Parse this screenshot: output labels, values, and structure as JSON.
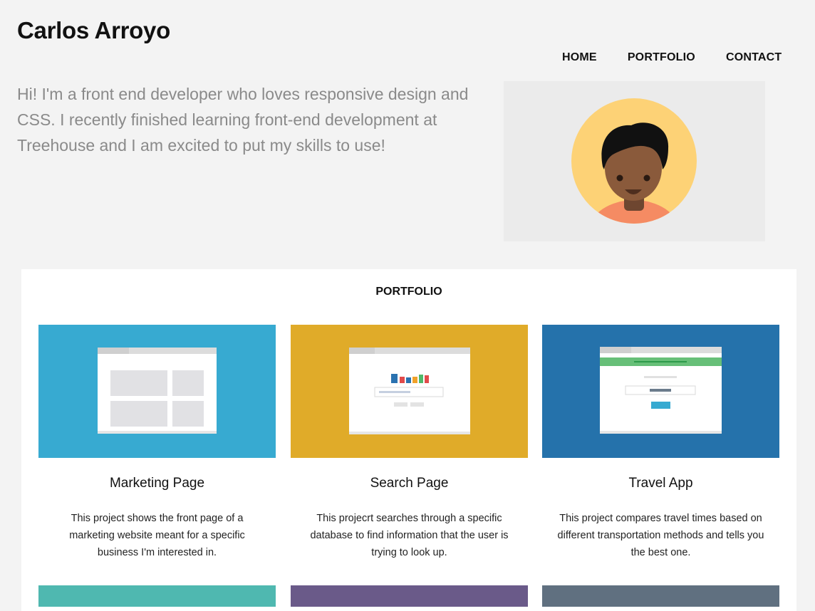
{
  "header": {
    "title": "Carlos Arroyo"
  },
  "nav": {
    "items": [
      {
        "label": "HOME"
      },
      {
        "label": "PORTFOLIO"
      },
      {
        "label": "CONTACT"
      }
    ]
  },
  "intro": {
    "text": "Hi! I'm a front end developer who loves responsive design and CSS. I recently finished learning front-end development at Treehouse and I am excited to put my skills to use!"
  },
  "avatar": {
    "icon": "person-avatar-icon",
    "background_color": "#fdd276",
    "skin_color": "#8a5a3b",
    "shirt_color": "#f58b63"
  },
  "portfolio": {
    "heading": "PORTFOLIO",
    "projects": [
      {
        "title": "Marketing Page",
        "description": "This project shows the front page of a marketing website meant for a specific business I'm interested in.",
        "color": "#37aad1",
        "thumbnail_icon": "wireframe-grid-icon"
      },
      {
        "title": "Search Page",
        "description": "This projecrt searches through a specific database to find information that the user is trying to look up.",
        "color": "#e0ab29",
        "thumbnail_icon": "search-page-icon"
      },
      {
        "title": "Travel App",
        "description": "This project compares travel times based on different transportation methods and tells you the best one.",
        "color": "#2572ab",
        "thumbnail_icon": "travel-app-icon"
      }
    ],
    "next_row_colors": [
      "#4fb8b0",
      "#6a5a89",
      "#607080"
    ]
  }
}
